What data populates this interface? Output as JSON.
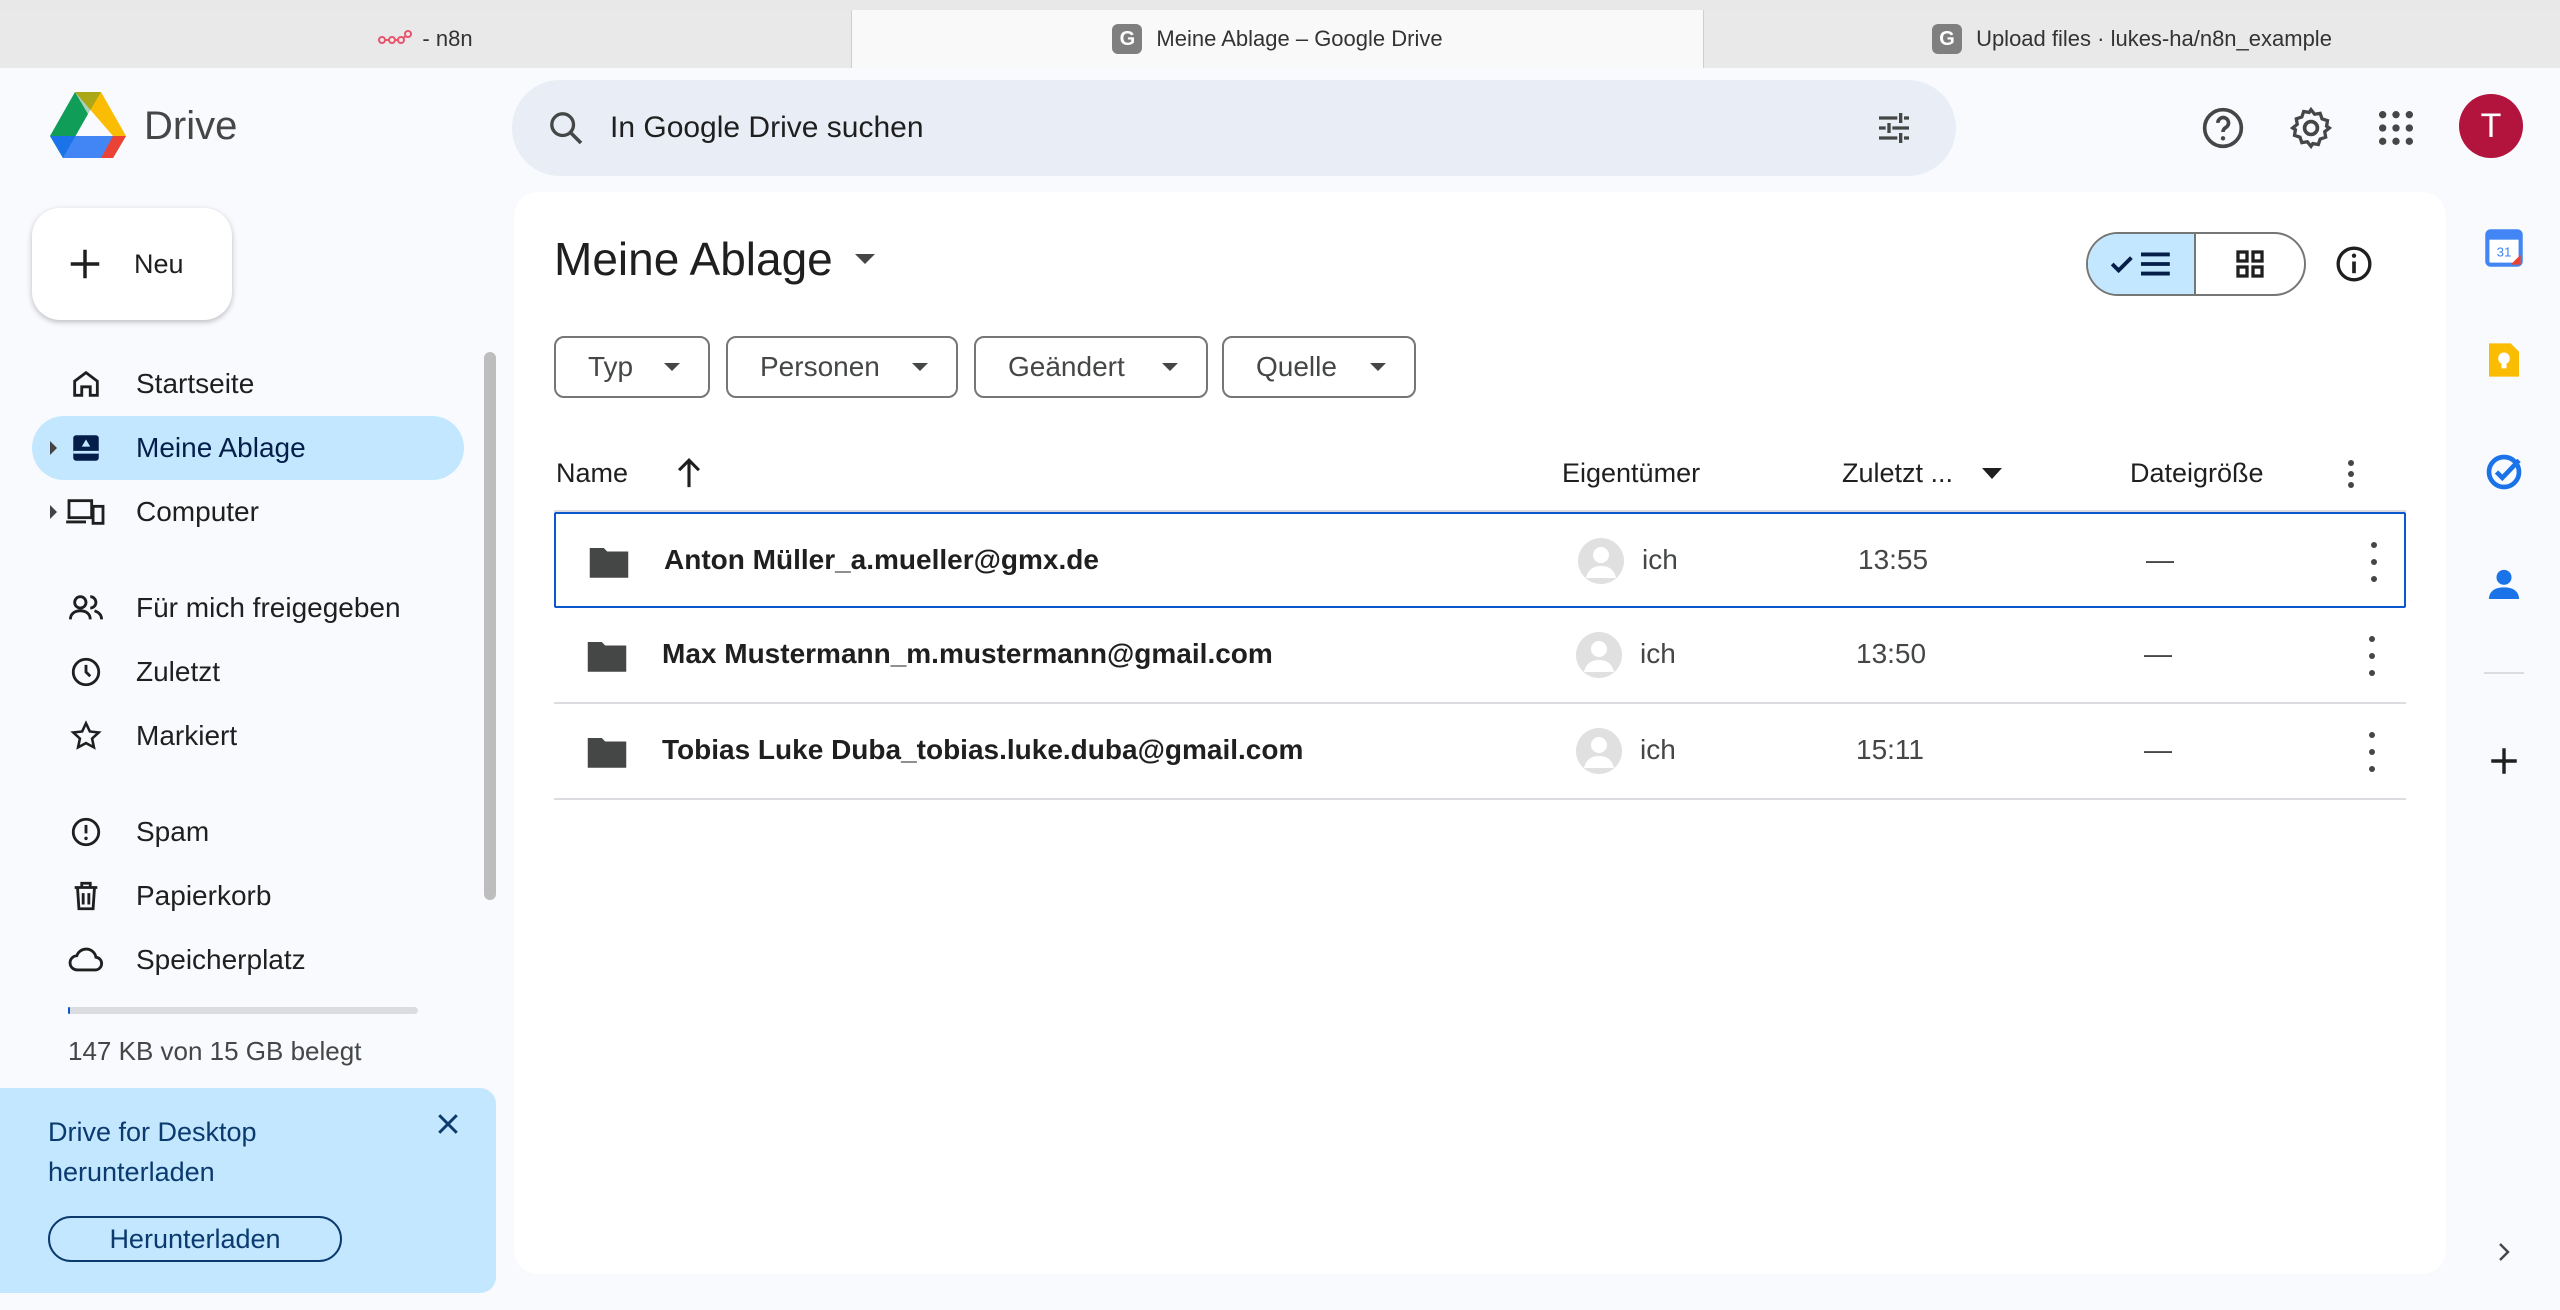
{
  "browser": {
    "tabs": [
      {
        "label": " - n8n",
        "active": false
      },
      {
        "label": "Meine Ablage – Google Drive",
        "active": true,
        "favicon": "G"
      },
      {
        "label": "Upload files · lukes-ha/n8n_example",
        "active": false,
        "favicon": "G"
      }
    ]
  },
  "header": {
    "app_name": "Drive",
    "search_placeholder": "In Google Drive suchen",
    "avatar_letter": "T",
    "icons": [
      "help-icon",
      "settings-icon",
      "apps-grid-icon"
    ]
  },
  "sidebar": {
    "new_label": "Neu",
    "items": [
      {
        "label": "Startseite",
        "icon": "home-icon"
      },
      {
        "label": "Meine Ablage",
        "icon": "my-drive-icon",
        "active": true
      },
      {
        "label": "Computer",
        "icon": "computer-icon"
      },
      {
        "label": "Für mich freigegeben",
        "icon": "shared-icon"
      },
      {
        "label": "Zuletzt",
        "icon": "clock-icon"
      },
      {
        "label": "Markiert",
        "icon": "star-icon"
      },
      {
        "label": "Spam",
        "icon": "spam-icon"
      },
      {
        "label": "Papierkorb",
        "icon": "trash-icon"
      },
      {
        "label": "Speicherplatz",
        "icon": "cloud-icon"
      }
    ],
    "storage_text": "147 KB von 15 GB belegt",
    "storage_used_fraction": 1e-05,
    "promo": {
      "title": "Drive for Desktop herunterladen",
      "button": "Herunterladen"
    }
  },
  "main": {
    "title": "Meine Ablage",
    "filters": [
      "Typ",
      "Personen",
      "Geändert",
      "Quelle"
    ],
    "columns": {
      "name": "Name",
      "owner": "Eigentümer",
      "modified": "Zuletzt ...",
      "size": "Dateigröße"
    },
    "rows": [
      {
        "name": "Anton Müller_a.mueller@gmx.de",
        "owner": "ich",
        "modified": "13:55",
        "size": "—",
        "selected": true
      },
      {
        "name": "Max Mustermann_m.mustermann@gmail.com",
        "owner": "ich",
        "modified": "13:50",
        "size": "—",
        "selected": false
      },
      {
        "name": "Tobias Luke Duba_tobias.luke.duba@gmail.com",
        "owner": "ich",
        "modified": "15:11",
        "size": "—",
        "selected": false
      }
    ]
  },
  "right_panel": {
    "calendar_day": "31",
    "apps": [
      "calendar-icon",
      "keep-icon",
      "tasks-icon",
      "contacts-icon",
      "add-icon"
    ]
  },
  "colors": {
    "accent": "#0b57d0",
    "selected_bg": "#c2e7ff",
    "avatar": "#b3143d"
  }
}
